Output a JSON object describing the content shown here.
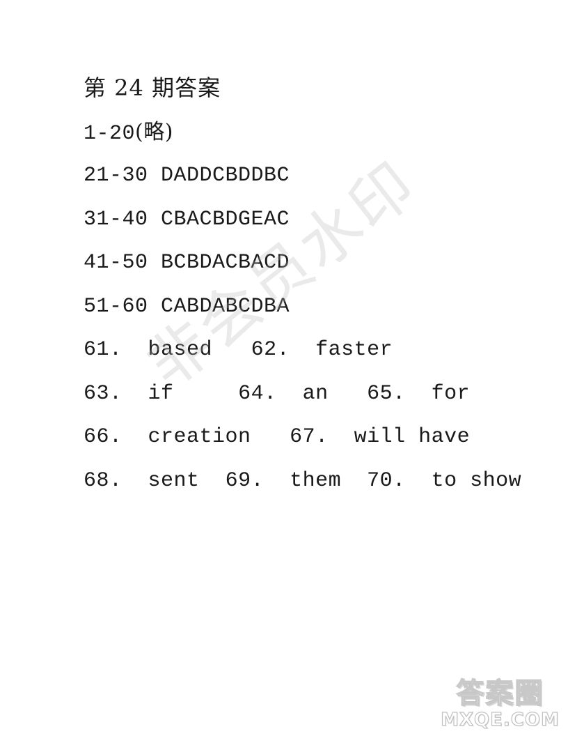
{
  "document": {
    "title": "第 24 期答案",
    "lines": [
      {
        "range": "1-20",
        "answers": "(略)"
      },
      {
        "range": "21-30",
        "answers": "DADDCBDDBC"
      },
      {
        "range": "31-40",
        "answers": "CBACBDGEAC"
      },
      {
        "range": "41-50",
        "answers": "BCBDACBACD"
      },
      {
        "range": "51-60",
        "answers": "CABDABCDBA"
      }
    ],
    "fill_in": [
      [
        {
          "num": "61.",
          "answer": "based"
        },
        {
          "num": "62.",
          "answer": "faster"
        }
      ],
      [
        {
          "num": "63.",
          "answer": "if"
        },
        {
          "num": "64.",
          "answer": "an"
        },
        {
          "num": "65.",
          "answer": "for"
        }
      ],
      [
        {
          "num": "66.",
          "answer": "creation"
        },
        {
          "num": "67.",
          "answer": "will have"
        }
      ],
      [
        {
          "num": "68.",
          "answer": "sent"
        },
        {
          "num": "69.",
          "answer": "them"
        },
        {
          "num": "70.",
          "answer": "to show"
        }
      ]
    ]
  },
  "watermark": {
    "text": "非会员水印"
  },
  "logo": {
    "cn": "答案圈",
    "en": "MXQE.COM"
  }
}
